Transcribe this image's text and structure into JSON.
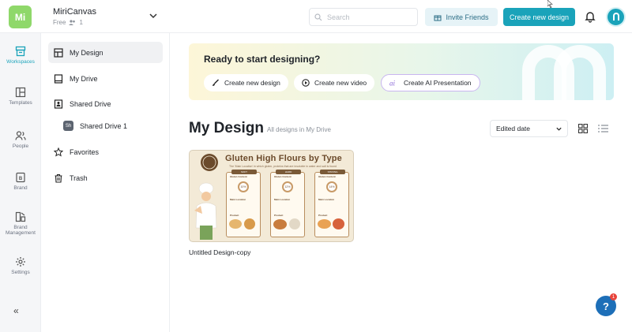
{
  "header": {
    "logo_text": "Mi",
    "workspace_name": "MiriCanvas",
    "plan": "Free",
    "member_count": "1",
    "search_placeholder": "Search",
    "invite_label": "Invite Friends",
    "create_label": "Create new design"
  },
  "rail": {
    "items": [
      {
        "label": "Workspaces",
        "icon": "workspaces-icon"
      },
      {
        "label": "Templates",
        "icon": "templates-icon"
      },
      {
        "label": "People",
        "icon": "people-icon"
      },
      {
        "label": "Brand",
        "icon": "brand-icon"
      },
      {
        "label": "Brand Management",
        "icon": "brand-management-icon"
      },
      {
        "label": "Settings",
        "icon": "gear-icon"
      }
    ],
    "collapse_label": "«"
  },
  "nav": {
    "my_design": "My Design",
    "my_drive": "My Drive",
    "shared_drive": "Shared Drive",
    "shared_drive_1_badge": "Sh",
    "shared_drive_1": "Shared Drive 1",
    "favorites": "Favorites",
    "trash": "Trash"
  },
  "banner": {
    "title": "Ready to start designing?",
    "btn_design": "Create new design",
    "btn_video": "Create new video",
    "btn_ai": "Create AI Presentation"
  },
  "main": {
    "title": "My Design",
    "subtitle": "All designs in My Drive",
    "sort_value": "Edited date"
  },
  "designs": [
    {
      "name": "Untitled Design-copy",
      "thumb_title": "Gluten High Flours by Type",
      "thumb_subtitle": "The 'Main Location' in which gluten, proteins that are insoluble in water and salt is found",
      "columns": [
        {
          "head": "SOFT",
          "pct": "10%"
        },
        {
          "head": "HARD",
          "pct": "12%"
        },
        {
          "head": "STRONG",
          "pct": "14%"
        }
      ],
      "row_labels": [
        "Gluten Content",
        "Main Location",
        "Product"
      ]
    }
  ],
  "help": {
    "label": "?",
    "badge": "1"
  },
  "colors": {
    "accent": "#1aa3ba",
    "logo": "#8fd86a"
  }
}
